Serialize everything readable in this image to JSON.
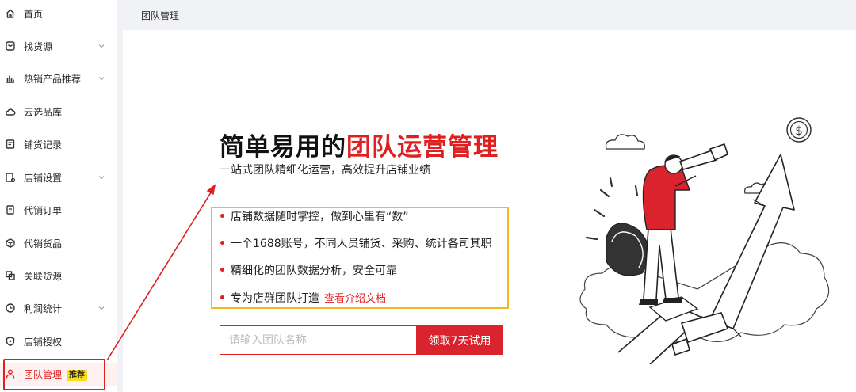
{
  "sidebar": {
    "items": [
      {
        "label": "首页",
        "icon": "home-icon",
        "has_chevron": false
      },
      {
        "label": "找货源",
        "icon": "source-icon",
        "has_chevron": true
      },
      {
        "label": "热销产品推荐",
        "icon": "bar-chart-icon",
        "has_chevron": true
      },
      {
        "label": "云选品库",
        "icon": "cloud-icon",
        "has_chevron": false
      },
      {
        "label": "铺货记录",
        "icon": "record-icon",
        "has_chevron": false
      },
      {
        "label": "店铺设置",
        "icon": "shop-settings-icon",
        "has_chevron": true
      },
      {
        "label": "代销订单",
        "icon": "order-icon",
        "has_chevron": false
      },
      {
        "label": "代销货品",
        "icon": "goods-icon",
        "has_chevron": false
      },
      {
        "label": "关联货源",
        "icon": "link-icon",
        "has_chevron": false
      },
      {
        "label": "利润统计",
        "icon": "clock-icon",
        "has_chevron": true
      },
      {
        "label": "店铺授权",
        "icon": "shield-icon",
        "has_chevron": false
      },
      {
        "label": "团队管理",
        "icon": "team-icon",
        "has_chevron": false,
        "badge": "推荐",
        "active": true
      }
    ]
  },
  "header": {
    "breadcrumb": "团队管理"
  },
  "hero": {
    "title_prefix": "简单易用的",
    "title_highlight": "团队运营管理",
    "subtitle": "一站式团队精细化运营，高效提升店铺业绩"
  },
  "features": [
    {
      "text": "店铺数据随时掌控，做到心里有“数”"
    },
    {
      "text": "一个1688账号，不同人员铺货、采购、统计各司其职"
    },
    {
      "text": "精细化的团队数据分析，安全可靠"
    },
    {
      "text": "专为店群团队打造",
      "link": "查看介绍文档"
    }
  ],
  "form": {
    "placeholder": "请输入团队名称",
    "value": "",
    "button": "领取7天试用"
  },
  "colors": {
    "accent": "#e02020",
    "highlight_box": "#f5b91e",
    "badge": "#fadb14"
  }
}
